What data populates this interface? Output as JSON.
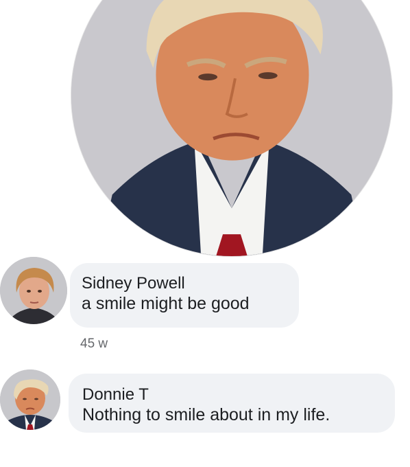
{
  "profile": {
    "photo_icon": "mugshot-portrait-photo"
  },
  "comments": [
    {
      "author": "Sidney Powell",
      "text": "a smile might be good",
      "timestamp": "45 w",
      "avatar_icon": "mugshot-avatar-photo"
    },
    {
      "author": "Donnie T",
      "text": "Nothing to smile about in my life.",
      "avatar_icon": "mugshot-avatar-photo"
    }
  ],
  "colors": {
    "bubble": "#f0f2f5",
    "text": "#1c1e21",
    "timestamp": "#65676b",
    "photo_background": "#c9c8cd"
  }
}
